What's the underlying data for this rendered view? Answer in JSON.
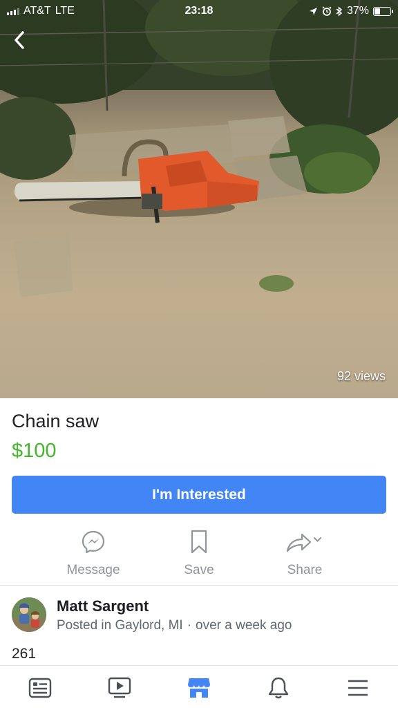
{
  "status_bar": {
    "carrier": "AT&T",
    "network": "LTE",
    "time": "23:18",
    "battery_percent": "37%",
    "battery_level": 0.37,
    "icons": [
      "location-arrow-icon",
      "alarm-icon",
      "bluetooth-icon"
    ]
  },
  "photo": {
    "subject": "orange chainsaw on dirt and paving stones",
    "views_text": "92 views"
  },
  "listing": {
    "title": "Chain saw",
    "price": "$100",
    "price_color": "#42b72a",
    "interested_label": "I'm Interested",
    "interested_color": "#4286f5"
  },
  "actions": {
    "message_label": "Message",
    "save_label": "Save",
    "share_label": "Share"
  },
  "seller": {
    "name": "Matt Sargent",
    "location_text": "Posted in Gaylord, MI",
    "separator": "·",
    "time_text": "over a week ago"
  },
  "count_text": "261",
  "tabbar": {
    "items": [
      {
        "icon": "news-feed-icon",
        "active": false
      },
      {
        "icon": "watch-video-icon",
        "active": false
      },
      {
        "icon": "marketplace-icon",
        "active": true
      },
      {
        "icon": "notifications-bell-icon",
        "active": false
      },
      {
        "icon": "menu-hamburger-icon",
        "active": false
      }
    ],
    "active_color": "#4286f5",
    "inactive_color": "#4b4f56"
  }
}
